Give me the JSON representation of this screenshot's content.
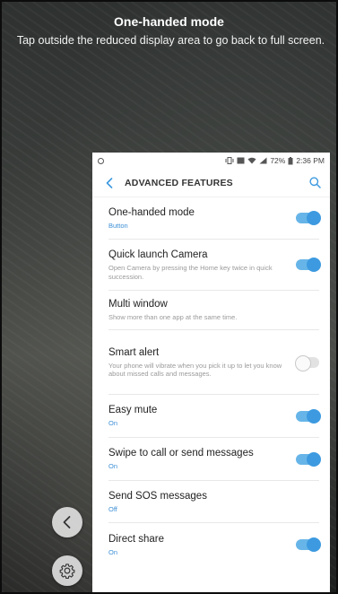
{
  "overlay": {
    "title": "One-handed mode",
    "description": "Tap outside the reduced display area to go back to full screen."
  },
  "status_bar": {
    "battery": "72%",
    "time": "2:36 PM"
  },
  "header": {
    "title": "ADVANCED FEATURES"
  },
  "settings": [
    {
      "name": "One-handed mode",
      "sub": "Button",
      "sub_color": "blue",
      "toggle": "on"
    },
    {
      "name": "Quick launch Camera",
      "sub": "Open Camera by pressing the Home key twice in quick succession.",
      "sub_color": "gray",
      "toggle": "on"
    },
    {
      "name": "Multi window",
      "sub": "Show more than one app at the same time.",
      "sub_color": "gray",
      "toggle": "none"
    },
    {
      "name": "Smart alert",
      "sub": "Your phone will vibrate when you pick it up to let you know about missed calls and messages.",
      "sub_color": "gray",
      "toggle": "off"
    },
    {
      "name": "Easy mute",
      "sub": "On",
      "sub_color": "blue",
      "toggle": "on"
    },
    {
      "name": "Swipe to call or send messages",
      "sub": "On",
      "sub_color": "blue",
      "toggle": "on"
    },
    {
      "name": "Send SOS messages",
      "sub": "Off",
      "sub_color": "blue",
      "toggle": "none"
    },
    {
      "name": "Direct share",
      "sub": "On",
      "sub_color": "blue",
      "toggle": "on"
    }
  ],
  "colors": {
    "accent": "#3d9ae0",
    "sub_blue": "#3d8fd6"
  }
}
